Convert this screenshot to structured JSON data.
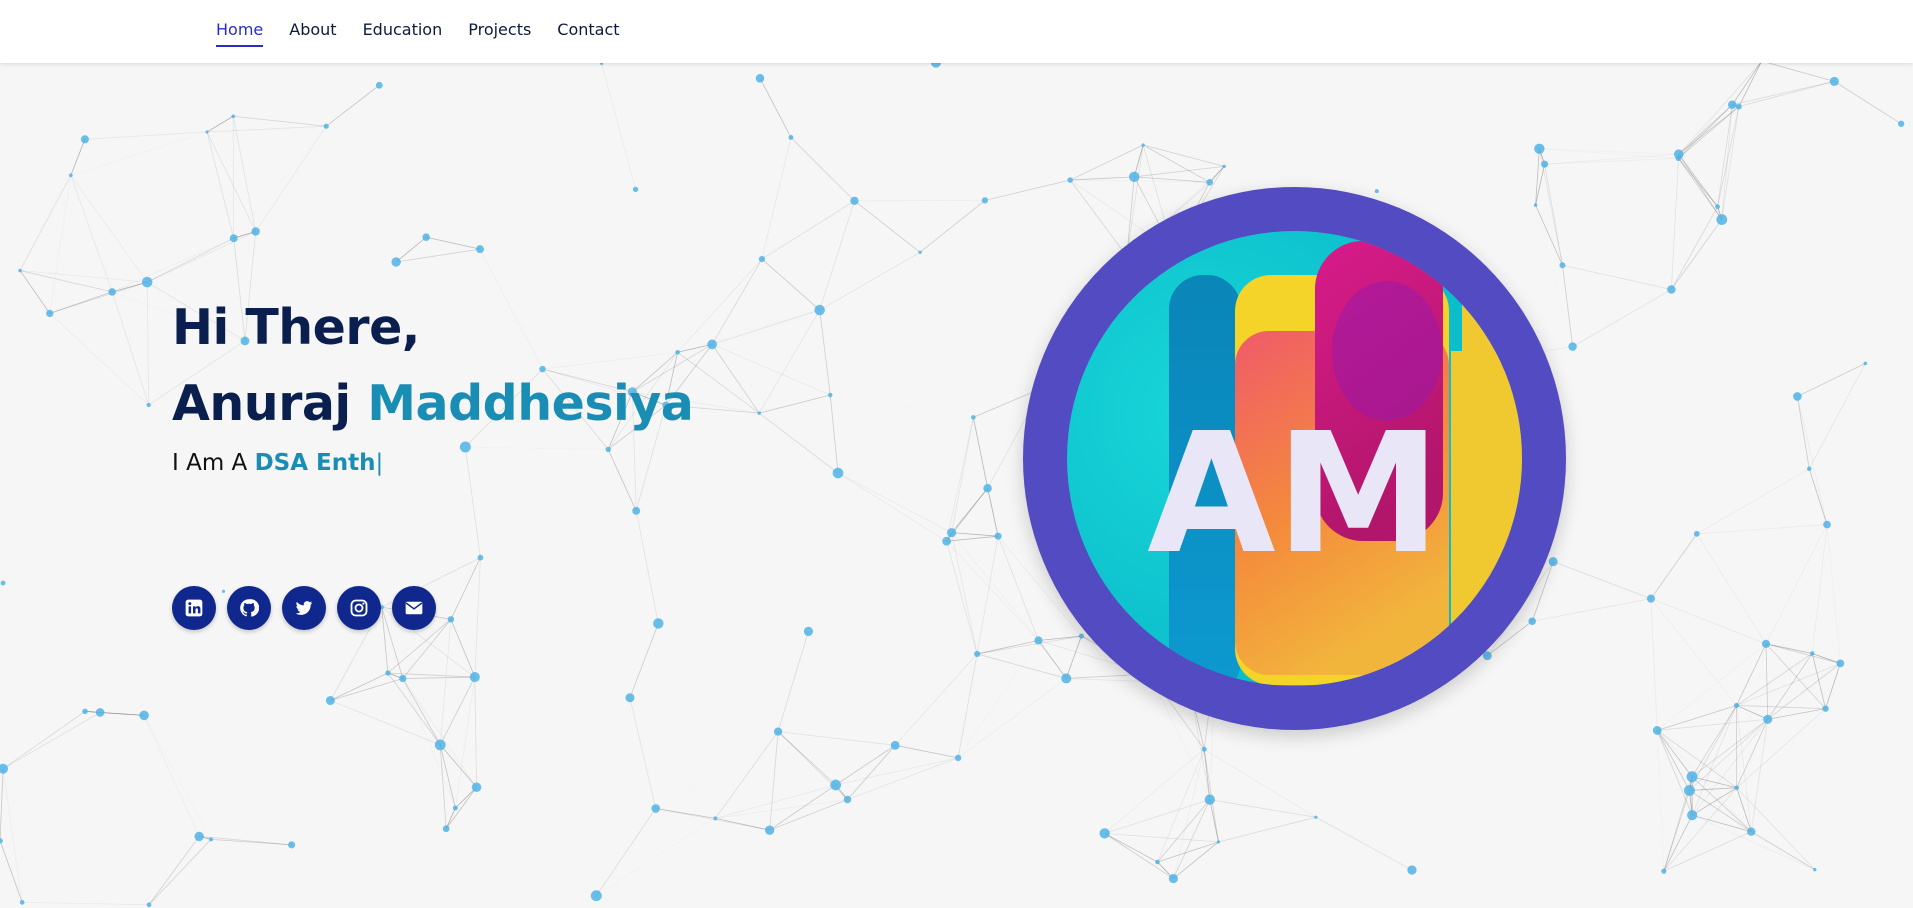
{
  "nav": {
    "items": [
      {
        "label": "Home",
        "active": true
      },
      {
        "label": "About",
        "active": false
      },
      {
        "label": "Education",
        "active": false
      },
      {
        "label": "Projects",
        "active": false
      },
      {
        "label": "Contact",
        "active": false
      }
    ]
  },
  "hero": {
    "greeting": "Hi There,",
    "first_name": "Anuraj",
    "last_name": "Maddhesiya",
    "typing_prefix": "I Am A",
    "typing_role": "DSA Enth",
    "caret": "|"
  },
  "avatar": {
    "initials": "AM"
  },
  "socials": [
    {
      "icon": "linkedin-icon"
    },
    {
      "icon": "github-icon"
    },
    {
      "icon": "twitter-icon"
    },
    {
      "icon": "instagram-icon"
    },
    {
      "icon": "envelope-icon"
    }
  ],
  "colors": {
    "brand_navy": "#0b1f4f",
    "accent_teal": "#1a8db5",
    "nav_active": "#2b2bc9",
    "social_bg": "#10288e",
    "avatar_ring": "#534bc2",
    "particle": "#4fb3e6"
  }
}
